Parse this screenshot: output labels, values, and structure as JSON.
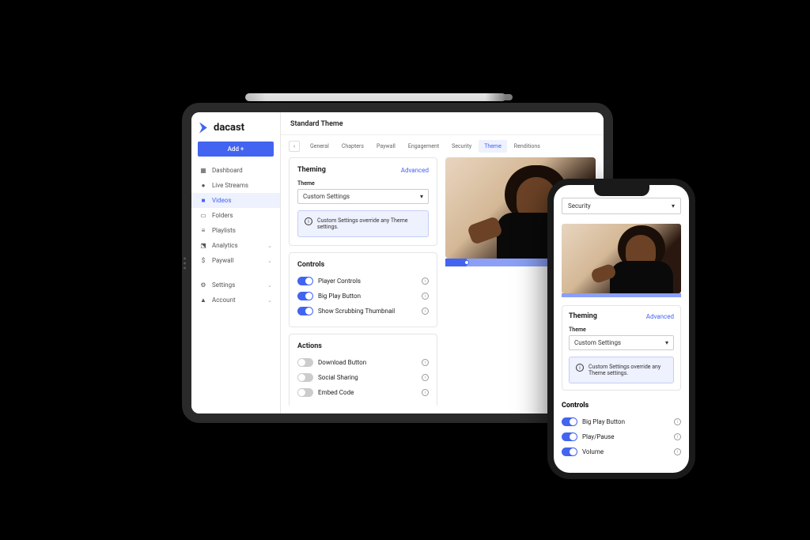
{
  "brand": "dacast",
  "sidebar": {
    "add_button": "Add +",
    "items": [
      {
        "icon": "dashboard",
        "label": "Dashboard"
      },
      {
        "icon": "live",
        "label": "Live Streams"
      },
      {
        "icon": "video",
        "label": "Videos"
      },
      {
        "icon": "folder",
        "label": "Folders"
      },
      {
        "icon": "playlist",
        "label": "Playlists"
      },
      {
        "icon": "analytics",
        "label": "Analytics"
      },
      {
        "icon": "paywall",
        "label": "Paywall"
      }
    ],
    "bottom": [
      {
        "icon": "settings",
        "label": "Settings"
      },
      {
        "icon": "account",
        "label": "Account"
      }
    ]
  },
  "page_title": "Standard Theme",
  "tabs": [
    "General",
    "Chapters",
    "Paywall",
    "Engagement",
    "Security",
    "Theme",
    "Renditions"
  ],
  "active_tab": "Theme",
  "theming": {
    "title": "Theming",
    "advanced": "Advanced",
    "field_label": "Theme",
    "select_value": "Custom Settings",
    "info_text": "Custom Settings override any Theme settings."
  },
  "controls": {
    "title": "Controls",
    "items": [
      {
        "label": "Player Controls",
        "on": true
      },
      {
        "label": "Big Play Button",
        "on": true
      },
      {
        "label": "Show Scrubbing Thumbnail",
        "on": true
      }
    ]
  },
  "actions": {
    "title": "Actions",
    "items": [
      {
        "label": "Download Button",
        "on": false
      },
      {
        "label": "Social Sharing",
        "on": false
      },
      {
        "label": "Embed Code",
        "on": false
      }
    ]
  },
  "phone": {
    "tab_value": "Security",
    "theming_title": "Theming",
    "advanced": "Advanced",
    "field_label": "Theme",
    "select_value": "Custom Settings",
    "info_text": "Custom Settings override any Theme settings.",
    "controls_title": "Controls",
    "controls": [
      {
        "label": "Big Play Button",
        "on": true
      },
      {
        "label": "Play/Pause",
        "on": true
      },
      {
        "label": "Volume",
        "on": true
      }
    ]
  }
}
